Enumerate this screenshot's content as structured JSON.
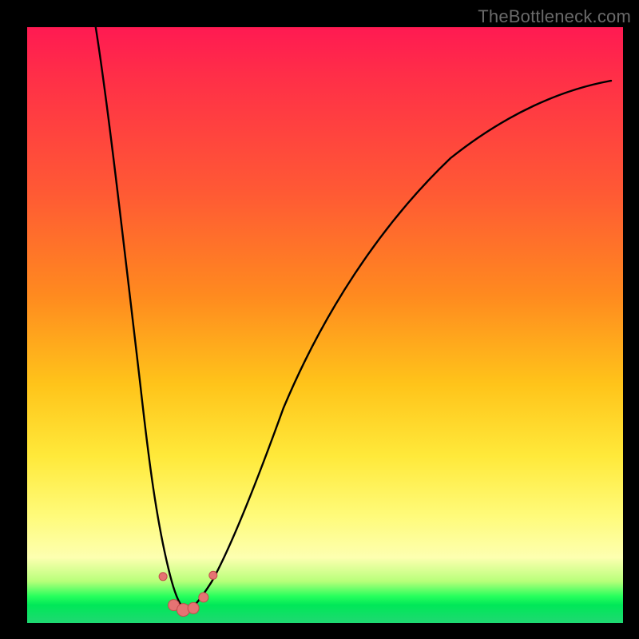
{
  "watermark": "TheBottleneck.com",
  "colors": {
    "page_bg": "#000000",
    "curve_stroke": "#000000",
    "marker_fill": "#e57373",
    "marker_stroke": "#c44d4d"
  },
  "chart_data": {
    "type": "line",
    "title": "",
    "xlabel": "",
    "ylabel": "",
    "xlim": [
      0,
      100
    ],
    "ylim": [
      0,
      100
    ],
    "grid": false,
    "legend": false,
    "note": "Axes are unlabeled in the source image; values below are read off by pixel position on a 0–100 normalized grid.",
    "series": [
      {
        "name": "curve",
        "x": [
          11.5,
          14,
          17,
          19,
          21,
          22.5,
          24,
          25.3,
          26.8,
          28.5,
          31,
          34,
          38,
          43,
          50,
          58,
          66,
          74,
          82,
          90,
          98
        ],
        "y": [
          100,
          80,
          58,
          40,
          25,
          15,
          8,
          3.5,
          2.2,
          3.0,
          7,
          14,
          24,
          36,
          50,
          62,
          72,
          79,
          84,
          88,
          91
        ]
      }
    ],
    "markers": [
      {
        "x": 22.8,
        "y": 7.8,
        "r": 5
      },
      {
        "x": 24.6,
        "y": 3.0,
        "r": 7
      },
      {
        "x": 26.2,
        "y": 2.2,
        "r": 8
      },
      {
        "x": 27.9,
        "y": 2.5,
        "r": 7
      },
      {
        "x": 29.6,
        "y": 4.3,
        "r": 6
      },
      {
        "x": 31.2,
        "y": 8.0,
        "r": 5
      }
    ]
  }
}
